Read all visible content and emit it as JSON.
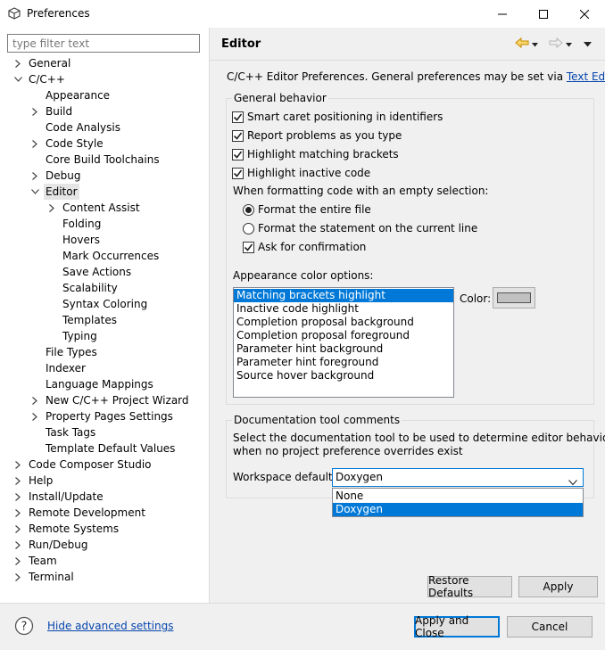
{
  "window": {
    "title": "Preferences"
  },
  "filter": {
    "placeholder": "type filter text"
  },
  "tree": [
    {
      "label": "General",
      "expander": "collapsed",
      "level": 0
    },
    {
      "label": "C/C++",
      "expander": "expanded",
      "level": 0
    },
    {
      "label": "Appearance",
      "expander": "none",
      "level": 1
    },
    {
      "label": "Build",
      "expander": "collapsed",
      "level": 1
    },
    {
      "label": "Code Analysis",
      "expander": "none",
      "level": 1
    },
    {
      "label": "Code Style",
      "expander": "collapsed",
      "level": 1
    },
    {
      "label": "Core Build Toolchains",
      "expander": "none",
      "level": 1
    },
    {
      "label": "Debug",
      "expander": "collapsed",
      "level": 1
    },
    {
      "label": "Editor",
      "expander": "expanded",
      "level": 1,
      "selected": true
    },
    {
      "label": "Content Assist",
      "expander": "collapsed",
      "level": 2
    },
    {
      "label": "Folding",
      "expander": "none",
      "level": 2
    },
    {
      "label": "Hovers",
      "expander": "none",
      "level": 2
    },
    {
      "label": "Mark Occurrences",
      "expander": "none",
      "level": 2
    },
    {
      "label": "Save Actions",
      "expander": "none",
      "level": 2
    },
    {
      "label": "Scalability",
      "expander": "none",
      "level": 2
    },
    {
      "label": "Syntax Coloring",
      "expander": "none",
      "level": 2
    },
    {
      "label": "Templates",
      "expander": "none",
      "level": 2
    },
    {
      "label": "Typing",
      "expander": "none",
      "level": 2
    },
    {
      "label": "File Types",
      "expander": "none",
      "level": 1
    },
    {
      "label": "Indexer",
      "expander": "none",
      "level": 1
    },
    {
      "label": "Language Mappings",
      "expander": "none",
      "level": 1
    },
    {
      "label": "New C/C++ Project Wizard",
      "expander": "collapsed",
      "level": 1
    },
    {
      "label": "Property Pages Settings",
      "expander": "collapsed",
      "level": 1
    },
    {
      "label": "Task Tags",
      "expander": "none",
      "level": 1
    },
    {
      "label": "Template Default Values",
      "expander": "none",
      "level": 1
    },
    {
      "label": "Code Composer Studio",
      "expander": "collapsed",
      "level": 0
    },
    {
      "label": "Help",
      "expander": "collapsed",
      "level": 0
    },
    {
      "label": "Install/Update",
      "expander": "collapsed",
      "level": 0
    },
    {
      "label": "Remote Development",
      "expander": "collapsed",
      "level": 0
    },
    {
      "label": "Remote Systems",
      "expander": "collapsed",
      "level": 0
    },
    {
      "label": "Run/Debug",
      "expander": "collapsed",
      "level": 0
    },
    {
      "label": "Team",
      "expander": "collapsed",
      "level": 0
    },
    {
      "label": "Terminal",
      "expander": "collapsed",
      "level": 0
    }
  ],
  "page": {
    "title": "Editor",
    "intro_text": "C/C++ Editor Preferences. General preferences may be set via ",
    "intro_link": "Text Editors",
    "intro_end": "."
  },
  "general_behavior": {
    "legend": "General behavior",
    "checkboxes": [
      {
        "label": "Smart caret positioning in identifiers",
        "checked": true
      },
      {
        "label": "Report problems as you type",
        "checked": true
      },
      {
        "label": "Highlight matching brackets",
        "checked": true
      },
      {
        "label": "Highlight inactive code",
        "checked": true
      }
    ],
    "formatting_label": "When formatting code with an empty selection:",
    "radios": [
      {
        "label": "Format the entire file",
        "selected": true
      },
      {
        "label": "Format the statement on the current line",
        "selected": false
      }
    ],
    "confirm": {
      "label": "Ask for confirmation",
      "checked": true
    },
    "appearance_label": "Appearance color options:",
    "color_options": [
      "Matching brackets highlight",
      "Inactive code highlight",
      "Completion proposal background",
      "Completion proposal foreground",
      "Parameter hint background",
      "Parameter hint foreground",
      "Source hover background"
    ],
    "selected_color_option": "Matching brackets highlight",
    "color_label": "Color:",
    "color_swatch": "#c0c0c0"
  },
  "doc_tool": {
    "legend": "Documentation tool comments",
    "description_line1": "Select the documentation tool to be used to determine editor behaviors",
    "description_line2": "when no project preference overrides exist",
    "workspace_label": "Workspace default:",
    "selected": "Doxygen",
    "options": [
      "None",
      "Doxygen"
    ]
  },
  "buttons": {
    "restore_defaults": "Restore Defaults",
    "apply": "Apply",
    "apply_and_close": "Apply and Close",
    "cancel": "Cancel"
  },
  "footer": {
    "hide_advanced": "Hide advanced settings"
  },
  "colors": {
    "selection": "#0078d7",
    "link": "#0645ad",
    "nav_arrow": "#e8a317"
  }
}
